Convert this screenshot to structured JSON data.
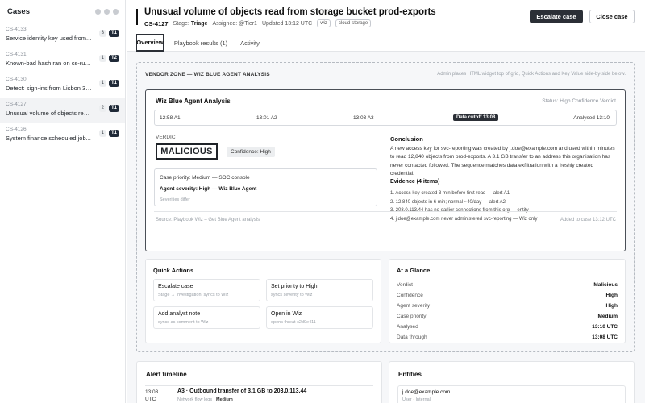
{
  "sidebar": {
    "title": "Cases",
    "cases": [
      {
        "id": "CS-4133",
        "name": "Service identity key used from...",
        "count": "3",
        "tier": "T1",
        "selected": false
      },
      {
        "id": "CS-4131",
        "name": "Known-bad hash ran on cs-runne...",
        "count": "1",
        "tier": "T2",
        "selected": false
      },
      {
        "id": "CS-4130",
        "name": "Detect: sign-ins from Lisbon 38...",
        "count": "1",
        "tier": "T1",
        "selected": false
      },
      {
        "id": "CS-4127",
        "name": "Unusual volume of objects read...",
        "count": "2",
        "tier": "T1",
        "selected": true
      },
      {
        "id": "CS-4126",
        "name": "System finance scheduled job...",
        "count": "1",
        "tier": "T1",
        "selected": false
      }
    ]
  },
  "header": {
    "title": "Unusual volume of objects read from storage bucket prod-exports",
    "case_id": "CS-4127",
    "stage_label": "Stage:",
    "stage_value": "Triage",
    "assigned_label": "Assigned:",
    "assigned_value": "@Tier1",
    "updated": "Updated 13:12 UTC",
    "tags": [
      "wiz",
      "cloud-storage"
    ],
    "escalate_label": "Escalate case",
    "close_label": "Close case"
  },
  "tabs": [
    "Overview",
    "Playbook results (1)",
    "Activity"
  ],
  "vendor_zone": {
    "label": "VENDOR ZONE — WIZ BLUE AGENT ANALYSIS",
    "note": "Admin places HTML widget top of grid, Quick Actions and Key Value side-by-side below."
  },
  "wiz": {
    "title": "Wiz Blue Agent Analysis",
    "status": "Status: High Confidence Verdict",
    "timeline": [
      "12:58 A1",
      "13:01 A2",
      "13:03 A3"
    ],
    "cutoff": "Data cutoff 13:08",
    "analysed": "Analysed 13:10",
    "verdict_label": "VERDICT",
    "verdict": "MALICIOUS",
    "confidence": "Confidence: High",
    "case_priority": "Case priority: Medium — SOC console",
    "agent_severity": "Agent severity: High — Wiz Blue Agent",
    "severities_note": "Severities differ",
    "conclusion_title": "Conclusion",
    "conclusion": "A new access key for svc-reporting was created by j.doe@example.com and used within minutes to read 12,840 objects from prod-exports. A 3.1 GB transfer to an address this organisation has never contacted followed. The sequence matches data exfiltration with a freshly created credential.",
    "evidence_title": "Evidence (4 items)",
    "evidence": [
      "1. Access key created 3 min before first read — alert A1",
      "2. 12,840 objects in 6 min; normal ~40/day — alert A2",
      "3. 203.0.113.44 has no earlier connections from this org — entity",
      "4. j.doe@example.com never administered svc-reporting — Wiz only"
    ],
    "source": "Source: Playbook Wiz – Get Blue Agent analysis",
    "added": "Added to case 13:12 UTC"
  },
  "quick_actions": {
    "title": "Quick Actions",
    "items": [
      {
        "title": "Escalate case",
        "sub": "Stage → investigation, syncs to Wiz"
      },
      {
        "title": "Set priority to High",
        "sub": "syncs severity to Wiz"
      },
      {
        "title": "Add analyst note",
        "sub": "syncs as comment to Wiz"
      },
      {
        "title": "Open in Wiz",
        "sub": "opens threat c2d9e411"
      }
    ]
  },
  "glance": {
    "title": "At a Glance",
    "rows": [
      {
        "k": "Verdict",
        "v": "Malicious"
      },
      {
        "k": "Confidence",
        "v": "High"
      },
      {
        "k": "Agent severity",
        "v": "High"
      },
      {
        "k": "Case priority",
        "v": "Medium"
      },
      {
        "k": "Analysed",
        "v": "13:10 UTC"
      },
      {
        "k": "Data through",
        "v": "13:08 UTC"
      }
    ]
  },
  "alert_timeline": {
    "title": "Alert timeline",
    "time": "13:03 UTC",
    "alert_title": "A3 · Outbound transfer of 3.1 GB to 203.0.113.44",
    "source": "Network flow logs",
    "severity": "Medium"
  },
  "entities": {
    "title": "Entities",
    "name": "j.doe@example.com",
    "sub": "User · Internal"
  }
}
